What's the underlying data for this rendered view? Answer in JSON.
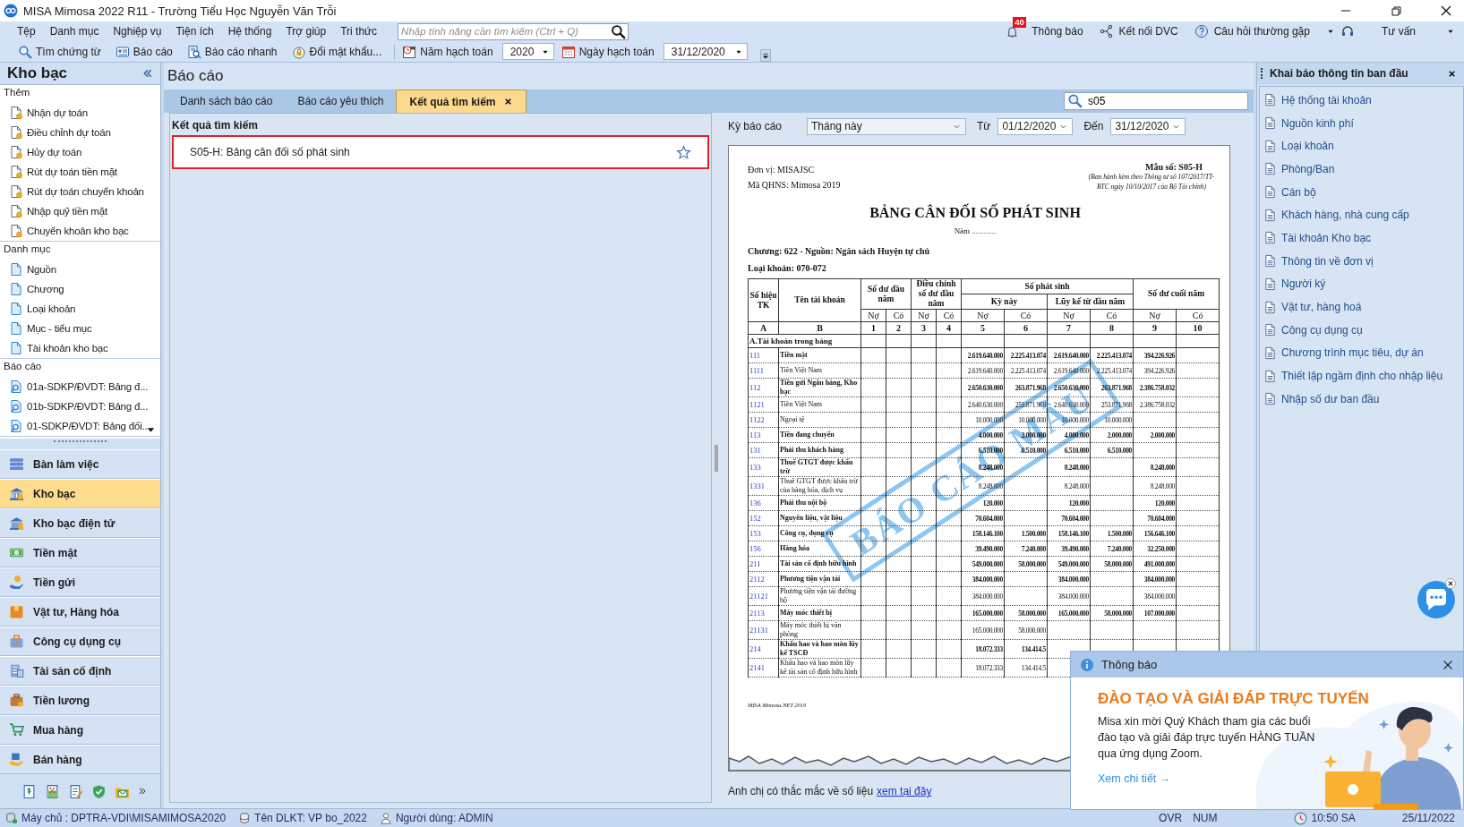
{
  "window": {
    "title": "MISA Mimosa 2022 R11 - Trường Tiểu Học Nguyễn Văn Trỗi"
  },
  "menu": {
    "items": [
      "Tệp",
      "Danh mục",
      "Nghiệp vụ",
      "Tiện ích",
      "Hệ thống",
      "Trợ giúp",
      "Tri thức"
    ],
    "search_placeholder": "Nhập tính năng cần tìm kiếm (Ctrl + Q)"
  },
  "top_links": {
    "notifications": "Thông báo",
    "badge": "40",
    "connect": "Kết nối DVC",
    "faq": "Câu hỏi thường gặp",
    "consult": "Tư vấn"
  },
  "toolbar": {
    "buttons": [
      "Tìm chứng từ",
      "Báo cáo",
      "Báo cáo nhanh",
      "Đổi mật khẩu..."
    ],
    "year_label": "Năm hạch toán",
    "year": "2020",
    "date_label": "Ngày hạch toán",
    "date": "31/12/2020"
  },
  "sidebar": {
    "title": "Kho bạc",
    "groups": [
      {
        "title": "Thêm",
        "kind": "add",
        "items": [
          "Nhận dự toán",
          "Điều chỉnh dự toán",
          "Hủy dự toán",
          "Rút dự toán tiền mặt",
          "Rút dự toán chuyển khoản",
          "Nhập quỹ tiền mặt",
          "Chuyển khoản kho bạc"
        ]
      },
      {
        "title": "Danh mục",
        "kind": "catalog",
        "items": [
          "Nguồn",
          "Chương",
          "Loại khoản",
          "Mục - tiểu mục",
          "Tài khoản kho bạc"
        ]
      },
      {
        "title": "Báo cáo",
        "kind": "report",
        "items": [
          "01a-SDKP/ĐVDT: Bảng đ...",
          "01b-SDKP/ĐVDT: Bảng đ...",
          "01-SDKP/ĐVDT: Bảng đối..."
        ]
      }
    ],
    "nav": [
      {
        "label": "Bàn làm việc",
        "selected": false
      },
      {
        "label": "Kho bạc",
        "selected": true
      },
      {
        "label": "Kho bạc điện tử",
        "selected": false
      },
      {
        "label": "Tiền mặt",
        "selected": false
      },
      {
        "label": "Tiền gửi",
        "selected": false
      },
      {
        "label": "Vật tư, Hàng hóa",
        "selected": false
      },
      {
        "label": "Công cụ dụng cụ",
        "selected": false
      },
      {
        "label": "Tài sản cố định",
        "selected": false
      },
      {
        "label": "Tiền lương",
        "selected": false
      },
      {
        "label": "Mua hàng",
        "selected": false
      },
      {
        "label": "Bán hàng",
        "selected": false
      }
    ]
  },
  "center": {
    "title": "Báo cáo",
    "tabs": [
      {
        "label": "Danh sách báo cáo",
        "selected": false,
        "closable": false
      },
      {
        "label": "Báo cáo yêu thích",
        "selected": false,
        "closable": false
      },
      {
        "label": "Kết quả tìm kiếm",
        "selected": true,
        "closable": true
      }
    ],
    "search": {
      "value": "s05"
    },
    "results": {
      "title": "Kết quả tìm kiếm",
      "items": [
        {
          "label": "S05-H: Bảng cân đối số phát sinh",
          "selected": true,
          "favorite": false
        }
      ]
    },
    "preview": {
      "period_label": "Kỳ báo cáo",
      "period": "Tháng này",
      "from_label": "Từ",
      "from": "01/12/2020",
      "to_label": "Đến",
      "to": "31/12/2020",
      "document": {
        "unit": "Đơn vị: MISAJSC",
        "code": "Mã QHNS: Mimosa 2019",
        "form_no": "Mẫu số: S05-H",
        "form_note": "(Ban hành kèm theo Thông tư số 107/2017/TT-BTC ngày 10/10/2017 của Bộ Tài chính)",
        "title": "BẢNG CÂN ĐỐI SỐ PHÁT SINH",
        "year": "Năm ............",
        "chapter": "Chương: 622 - Nguồn: Ngân sách Huyện tự chủ",
        "category": "Loại khoản: 070-072",
        "header": {
          "account_no": "Số hiệu TK",
          "account_name": "Tên tài khoản",
          "opening": "Số dư đầu năm",
          "adjust": "Điều chỉnh số dư đầu năm",
          "movement": "Số phát sinh",
          "period": "Kỳ này",
          "cumulative": "Lũy kế từ đầu năm",
          "closing": "Số dư cuối năm",
          "sides": [
            "Nợ",
            "Có",
            "Nợ",
            "Có",
            "Nợ",
            "Có",
            "Nợ",
            "Có",
            "Nợ",
            "Có"
          ],
          "index": [
            "A",
            "B",
            "1",
            "2",
            "3",
            "4",
            "5",
            "6",
            "7",
            "8",
            "9",
            "10"
          ]
        },
        "section": "A.Tài khoản trong bảng",
        "rows": [
          {
            "code": "111",
            "name": "Tiền mặt",
            "bold": true,
            "values": {
              "c5": "2.619.640.000",
              "c6": "2.225.413.074",
              "c7": "2.619.640.000",
              "c8": "2.225.413.074",
              "c9": "394.226.926"
            }
          },
          {
            "code": "1111",
            "name": "Tiền Việt Nam",
            "bold": false,
            "values": {
              "c5": "2.619.640.000",
              "c6": "2.225.413.074",
              "c7": "2.619.640.000",
              "c8": "2.225.413.074",
              "c9": "394.226.926"
            }
          },
          {
            "code": "112",
            "name": "Tiền gửi Ngân hàng, Kho bạc",
            "bold": true,
            "values": {
              "c5": "2.650.630.000",
              "c6": "263.871.968",
              "c7": "2.650.630.000",
              "c8": "263.871.968",
              "c9": "2.386.758.032"
            }
          },
          {
            "code": "1121",
            "name": "Tiền Việt Nam",
            "bold": false,
            "values": {
              "c5": "2.640.630.000",
              "c6": "253.871.968",
              "c7": "2.640.630.000",
              "c8": "253.871.968",
              "c9": "2.386.758.032"
            }
          },
          {
            "code": "1122",
            "name": "Ngoại tệ",
            "bold": false,
            "values": {
              "c5": "10.000.000",
              "c6": "10.000.000",
              "c7": "10.000.000",
              "c8": "10.000.000"
            }
          },
          {
            "code": "113",
            "name": "Tiền đang chuyển",
            "bold": true,
            "values": {
              "c5": "4.000.000",
              "c6": "2.000.000",
              "c7": "4.000.000",
              "c8": "2.000.000",
              "c9": "2.000.000"
            }
          },
          {
            "code": "131",
            "name": "Phải thu khách hàng",
            "bold": true,
            "values": {
              "c5": "6.510.000",
              "c6": "6.510.000",
              "c7": "6.510.000",
              "c8": "6.510.000"
            }
          },
          {
            "code": "133",
            "name": "Thuế GTGT được khấu trừ",
            "bold": true,
            "values": {
              "c5": "8.248.000",
              "c7": "8.248.000",
              "c9": "8.248.000"
            }
          },
          {
            "code": "1331",
            "name": "Thuế GTGT được khấu trừ của hàng hóa, dịch vụ",
            "bold": false,
            "values": {
              "c5": "8.248.000",
              "c7": "8.248.000",
              "c9": "8.248.000"
            }
          },
          {
            "code": "136",
            "name": "Phải thu nội bộ",
            "bold": true,
            "values": {
              "c5": "120.000",
              "c7": "120.000",
              "c9": "120.000"
            }
          },
          {
            "code": "152",
            "name": "Nguyên liệu, vật liệu",
            "bold": true,
            "values": {
              "c5": "70.604.000",
              "c7": "70.604.000",
              "c9": "70.604.000"
            }
          },
          {
            "code": "153",
            "name": "Công cụ, dụng cụ",
            "bold": true,
            "values": {
              "c5": "158.146.100",
              "c6": "1.500.000",
              "c7": "158.146.100",
              "c8": "1.500.000",
              "c9": "156.646.100"
            }
          },
          {
            "code": "156",
            "name": "Hàng hóa",
            "bold": true,
            "values": {
              "c5": "39.490.000",
              "c6": "7.240.000",
              "c7": "39.490.000",
              "c8": "7.240.000",
              "c9": "32.250.000"
            }
          },
          {
            "code": "211",
            "name": "Tài sản cố định hữu hình",
            "bold": true,
            "values": {
              "c5": "549.000.000",
              "c6": "58.000.000",
              "c7": "549.000.000",
              "c8": "58.000.000",
              "c9": "491.000.000"
            }
          },
          {
            "code": "2112",
            "name": "Phương tiện vận tải",
            "bold": true,
            "values": {
              "c5": "384.000.000",
              "c7": "384.000.000",
              "c9": "384.000.000"
            }
          },
          {
            "code": "21121",
            "name": "Phương tiện vận tải đường bộ",
            "bold": false,
            "values": {
              "c5": "384.000.000",
              "c7": "384.000.000",
              "c9": "384.000.000"
            }
          },
          {
            "code": "2113",
            "name": "Máy móc thiết bị",
            "bold": true,
            "values": {
              "c5": "165.000.000",
              "c6": "58.000.000",
              "c7": "165.000.000",
              "c8": "58.000.000",
              "c9": "107.000.000"
            }
          },
          {
            "code": "21131",
            "name": "Máy móc thiết bị văn phòng",
            "bold": false,
            "values": {
              "c5": "165.000.000",
              "c6": "58.000.000"
            }
          },
          {
            "code": "214",
            "name": "Khấu hao và hao mòn lũy kế TSCĐ",
            "bold": true,
            "values": {
              "c5": "18.072.333",
              "c6": "134.414.5"
            }
          },
          {
            "code": "2141",
            "name": "Khấu hao và hao mòn lũy kế tài sản cố định hữu hình",
            "bold": false,
            "values": {
              "c5": "18.072.333",
              "c6": "134.414.5"
            }
          }
        ],
        "footer": "MISA Mimosa.NET 2019",
        "stamp": "BÁO CÁO MẪU"
      },
      "help_text": "Anh chị có thắc mắc về số liệu",
      "help_link": "xem tại đây"
    }
  },
  "right_panel": {
    "title": "Khai báo thông tin ban đầu",
    "items": [
      "Hệ thống tài khoản",
      "Nguồn kinh phí",
      "Loại khoản",
      "Phòng/Ban",
      "Cán bộ",
      "Khách hàng, nhà cung cấp",
      "Tài khoản Kho bạc",
      "Thông tin về đơn vị",
      "Người ký",
      "Vật tư, hàng hoá",
      "Công cụ dụng cụ",
      "Chương trình mục tiêu, dự án",
      "Thiết lập ngầm định cho nhập liệu",
      "Nhập số dư ban đầu"
    ]
  },
  "popup": {
    "title": "Thông báo",
    "heading": "ĐÀO TẠO VÀ GIẢI ĐÁP TRỰC TUYẾN",
    "body": "Misa xin mời Quý Khách tham gia các buổi đào tạo và giải đáp trực tuyến HÀNG TUẦN qua ứng dụng Zoom.",
    "link": "Xem chi tiết →"
  },
  "status_bar": {
    "server": "Máy chủ : DPTRA-VDI\\MISAMIMOSA2020",
    "database": "Tên DLKT: VP bo_2022",
    "user": "Người dùng: ADMIN",
    "ovr": "OVR",
    "num": "NUM",
    "time": "10:50 SA",
    "date": "25/11/2022"
  }
}
